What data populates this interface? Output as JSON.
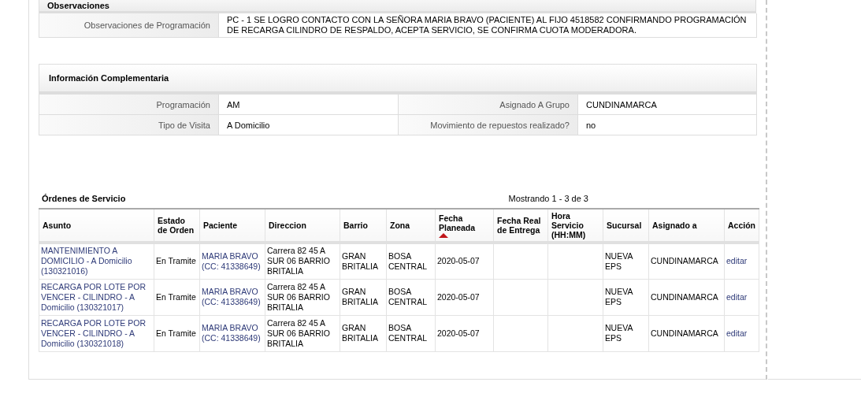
{
  "observaciones": {
    "title": "Observaciones",
    "label": "Observaciones de Programación",
    "value": "PC - 1 SE LOGRO CONTACTO CON LA SEÑORA MARIA BRAVO (PACIENTE) AL FIJO 4518582 CONFIRMANDO PROGRAMACIÓN DE RECARGA CILINDRO DE RESPALDO, ACEPTA SERVICIO, SE CONFIRMA CUOTA MODERADORA."
  },
  "info": {
    "title": "Información Complementaria",
    "rows": [
      [
        {
          "label": "Programación",
          "value": "AM"
        },
        {
          "label": "Asignado A Grupo",
          "value": "CUNDINAMARCA"
        }
      ],
      [
        {
          "label": "Tipo de Visita",
          "value": "A Domicilio"
        },
        {
          "label": "Movimiento de repuestos realizado?",
          "value": "no"
        }
      ]
    ]
  },
  "orders": {
    "title": "Órdenes de Servicio",
    "paging": "Mostrando 1 - 3 de 3",
    "columns": [
      {
        "label": "Asunto",
        "sorted": false
      },
      {
        "label": "Estado de Orden",
        "sorted": false
      },
      {
        "label": "Paciente",
        "sorted": false
      },
      {
        "label": "Direccion",
        "sorted": false
      },
      {
        "label": "Barrio",
        "sorted": false
      },
      {
        "label": "Zona",
        "sorted": false
      },
      {
        "label": "Fecha Planeada",
        "sorted": true
      },
      {
        "label": "Fecha Real de Entrega",
        "sorted": false
      },
      {
        "label": "Hora Servicio (HH:MM)",
        "sorted": false
      },
      {
        "label": "Sucursal",
        "sorted": false
      },
      {
        "label": "Asignado a",
        "sorted": false
      },
      {
        "label": "Acción",
        "sorted": false
      }
    ],
    "rows": [
      {
        "asunto": "MANTENIMIENTO A DOMICILIO - A Domicilio (130321016)",
        "estado": "En Tramite",
        "paciente": "MARIA BRAVO (CC: 41338649)",
        "direccion": "Carrera 82 45 A SUR 06 BARRIO BRITALIA",
        "barrio": "GRAN BRITALIA",
        "zona": "BOSA CENTRAL",
        "fecha_planeada": "2020-05-07",
        "sucursal": "NUEVA EPS",
        "asignado": "CUNDINAMARCA",
        "accion": "editar"
      },
      {
        "asunto": "RECARGA POR LOTE POR VENCER - CILINDRO - A Domicilio (130321017)",
        "estado": "En Tramite",
        "paciente": "MARIA BRAVO (CC: 41338649)",
        "direccion": "Carrera 82 45 A SUR 06 BARRIO BRITALIA",
        "barrio": "GRAN BRITALIA",
        "zona": "BOSA CENTRAL",
        "fecha_planeada": "2020-05-07",
        "sucursal": "NUEVA EPS",
        "asignado": "CUNDINAMARCA",
        "accion": "editar"
      },
      {
        "asunto": "RECARGA POR LOTE POR VENCER - CILINDRO - A Domicilio (130321018)",
        "estado": "En Tramite",
        "paciente": "MARIA BRAVO (CC: 41338649)",
        "direccion": "Carrera 82 45 A SUR 06 BARRIO BRITALIA",
        "barrio": "GRAN BRITALIA",
        "zona": "BOSA CENTRAL",
        "fecha_planeada": "2020-05-07",
        "sucursal": "NUEVA EPS",
        "asignado": "CUNDINAMARCA",
        "accion": "editar"
      }
    ]
  }
}
